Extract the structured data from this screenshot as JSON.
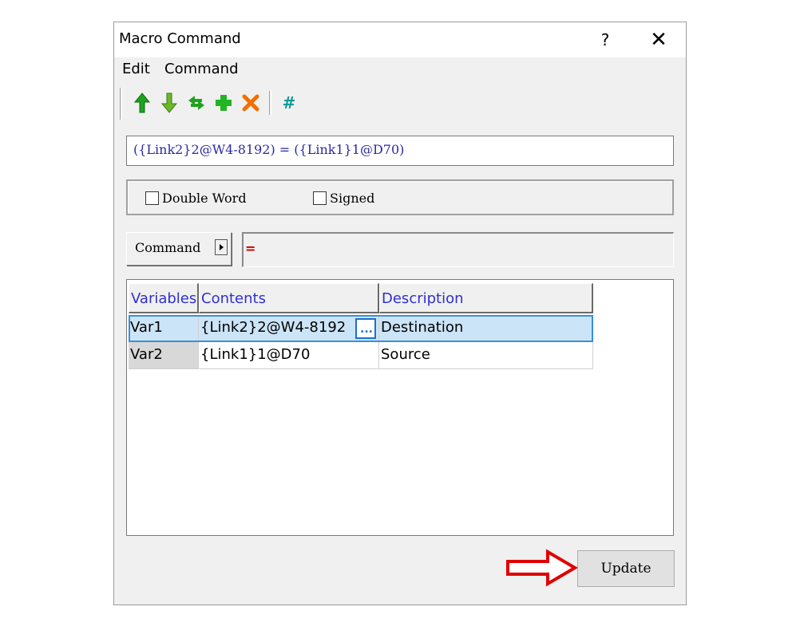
{
  "window": {
    "title": "Macro Command",
    "help_label": "?",
    "close_label": "✕"
  },
  "menu": {
    "items": [
      {
        "label": "Edit"
      },
      {
        "label": "Command"
      }
    ]
  },
  "toolbar": {
    "icons": [
      {
        "name": "move-up-icon",
        "color": "#1fa31f"
      },
      {
        "name": "move-down-icon",
        "color": "#6ab82a"
      },
      {
        "name": "swap-icon",
        "color": "#1fa31f"
      },
      {
        "name": "add-icon",
        "color": "#21b521"
      },
      {
        "name": "delete-icon",
        "color": "#f07000"
      },
      {
        "name": "hash-icon",
        "color": "#0f9a9a",
        "glyph": "#"
      }
    ]
  },
  "expression": "({Link2}2@W4-8192) = ({Link1}1@D70)",
  "options": {
    "double_word": {
      "label": "Double Word",
      "checked": false
    },
    "signed": {
      "label": "Signed",
      "checked": false
    }
  },
  "command": {
    "label": "Command",
    "operator": "="
  },
  "grid": {
    "columns": [
      "Variables",
      "Contents",
      "Description"
    ],
    "rows": [
      {
        "variable": "Var1",
        "contents": "{Link2}2@W4-8192",
        "description": "Destination",
        "selected": true
      },
      {
        "variable": "Var2",
        "contents": "{Link1}1@D70",
        "description": "Source",
        "selected": false
      }
    ]
  },
  "update_label": "Update",
  "colors": {
    "accent_blue": "#3030d0",
    "selection": "#cce4f7",
    "arrow_red": "#e00000"
  }
}
